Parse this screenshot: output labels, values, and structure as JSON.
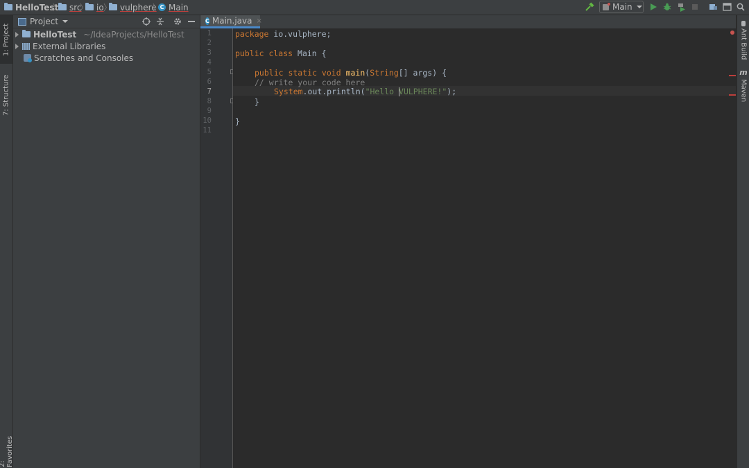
{
  "breadcrumb": [
    {
      "label": "HelloTest",
      "icon": "project-folder-icon"
    },
    {
      "label": "src",
      "icon": "folder-icon"
    },
    {
      "label": "io",
      "icon": "folder-icon"
    },
    {
      "label": "vulphere",
      "icon": "folder-icon"
    },
    {
      "label": "Main",
      "icon": "class-icon"
    }
  ],
  "toolbar": {
    "run_config": "Main",
    "icons": [
      "build-hammer-icon",
      "run-icon",
      "debug-icon",
      "coverage-icon",
      "stop-icon",
      "project-structure-icon",
      "terminal-layout-icon",
      "search-icon"
    ]
  },
  "left_stripe": {
    "project_tab": "1: Project",
    "structure_tab": "7: Structure",
    "favorites_tab": "2: Favorites"
  },
  "project_panel": {
    "title": "Project",
    "tree": [
      {
        "label": "HelloTest",
        "path": "~/IdeaProjects/HelloTest",
        "expandable": true
      },
      {
        "label": "External Libraries",
        "expandable": true
      },
      {
        "label": "Scratches and Consoles",
        "expandable": false
      }
    ]
  },
  "editor": {
    "tab_label": "Main.java",
    "current_line": 7,
    "line_numbers": [
      "1",
      "2",
      "3",
      "4",
      "5",
      "6",
      "7",
      "8",
      "9",
      "10",
      "11"
    ],
    "code": {
      "l1_kw": "package",
      "l1_rest": " io.vulphere;",
      "l3_kw": "public class",
      "l3_rest": " Main {",
      "l5_kw": "public static void",
      "l5_fn": "main",
      "l5_paren": "(",
      "l5_type": "String",
      "l5_rest": "[] args) {",
      "l6_comment": "// write your code here",
      "l7_sys": "System",
      "l7_mid": ".out.println(",
      "l7_str_a": "\"Hello ",
      "l7_str_b": "VULPHERE!\"",
      "l7_end": ");",
      "l8": "}",
      "l10": "}"
    }
  },
  "right_stripe": {
    "ant_tab": "Ant Build",
    "maven_tab": "Maven"
  },
  "colors": {
    "keyword": "#cc7832",
    "function": "#ffc66d",
    "string": "#6a8759",
    "comment": "#808080",
    "error": "#bc3f3c",
    "accent": "#4a88c7"
  }
}
